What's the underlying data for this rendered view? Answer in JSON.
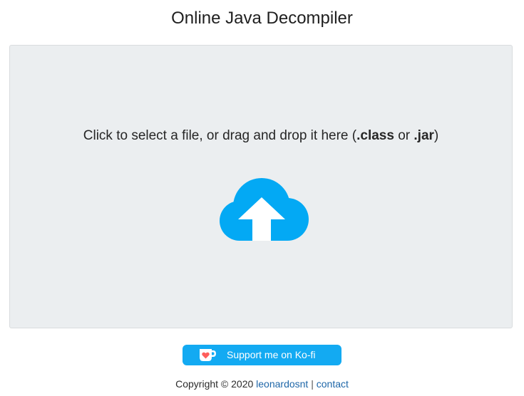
{
  "header": {
    "title": "Online Java Decompiler"
  },
  "dropzone": {
    "text_prefix": "Click to select a file, or drag and drop it here (",
    "ext_class": ".class",
    "text_or": " or ",
    "ext_jar": ".jar",
    "text_suffix": ")",
    "icon": "cloud-upload-icon",
    "icon_color": "#03a9f4",
    "background_color": "#ebeef0"
  },
  "kofi": {
    "label": "Support me on Ko-fi",
    "icon": "kofi-cup-icon",
    "button_color": "#13aaf2",
    "heart_color": "#ff5e5b"
  },
  "footer": {
    "copyright": "Copyright © 2020 ",
    "author_link": "leonardosnt",
    "separator": " | ",
    "contact_link": "contact",
    "link_color": "#1e66a8"
  }
}
